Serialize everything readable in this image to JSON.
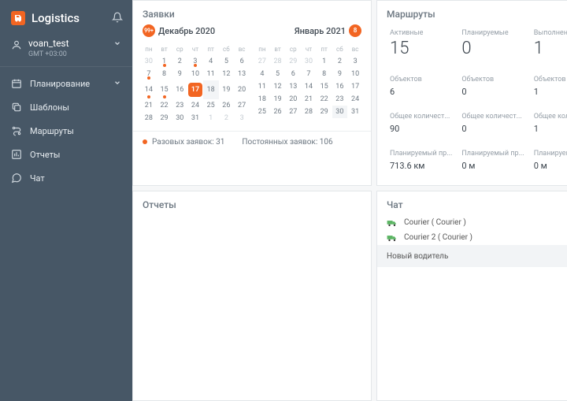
{
  "app": {
    "title": "Logistics"
  },
  "user": {
    "name": "voan_test",
    "tz": "GMT +03:00"
  },
  "nav": {
    "planning": "Планирование",
    "templates": "Шаблоны",
    "routes": "Маршруты",
    "reports": "Отчеты",
    "chat": "Чат"
  },
  "requests": {
    "title": "Заявки",
    "month1_name": "Декабрь 2020",
    "month1_badge": "99+",
    "month2_name": "Январь 2021",
    "month2_badge": "8",
    "weekdays": [
      "пн",
      "вт",
      "ср",
      "чт",
      "пт",
      "сб",
      "вс"
    ],
    "today": "17",
    "footer_single": "Разовых заявок: 31",
    "footer_perm": "Постоянных заявок: 106"
  },
  "routes": {
    "title": "Маршруты",
    "cols": {
      "active": "Активные",
      "planned": "Планируемые",
      "done": "Выполненные"
    },
    "vals_routes": {
      "active": "15",
      "planned": "0",
      "done": "1"
    },
    "label_objects": "Объектов",
    "vals_objects": {
      "active": "6",
      "planned": "0",
      "done": "1"
    },
    "label_total": "Общее количест...",
    "vals_total": {
      "active": "90",
      "planned": "0",
      "done": "1"
    },
    "label_dist": "Планируемый пр...",
    "vals_dist": {
      "active": "713.6 км",
      "planned": "0 м",
      "done": "0 м"
    }
  },
  "reports": {
    "title": "Отчеты"
  },
  "chat": {
    "title": "Чат",
    "rows": [
      {
        "label": "Courier ( Courier )"
      },
      {
        "label": "Courier 2 ( Courier )"
      },
      {
        "label": "Новый водитель"
      }
    ]
  }
}
